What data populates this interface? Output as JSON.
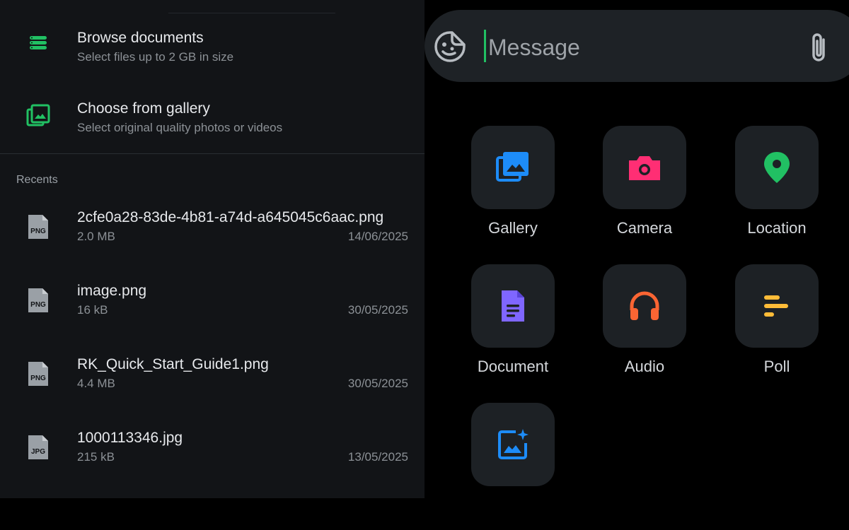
{
  "attach_panel": {
    "options": [
      {
        "title": "Browse documents",
        "subtitle": "Select files up to 2 GB in size",
        "icon": "document-stack-icon"
      },
      {
        "title": "Choose from gallery",
        "subtitle": "Select original quality photos or videos",
        "icon": "gallery-icon"
      }
    ],
    "recents_label": "Recents",
    "files": [
      {
        "name": "2cfe0a28-83de-4b81-a74d-a645045c6aac.png",
        "size": "2.0 MB",
        "date": "14/06/2025",
        "type": "PNG"
      },
      {
        "name": "image.png",
        "size": "16 kB",
        "date": "30/05/2025",
        "type": "PNG"
      },
      {
        "name": "RK_Quick_Start_Guide1.png",
        "size": "4.4 MB",
        "date": "30/05/2025",
        "type": "PNG"
      },
      {
        "name": "1000113346.jpg",
        "size": "215 kB",
        "date": "13/05/2025",
        "type": "JPG"
      }
    ]
  },
  "composer": {
    "placeholder": "Message",
    "left_icon": "sticker-icon",
    "right_icon": "paperclip-icon"
  },
  "attach_menu": {
    "items": [
      {
        "label": "Gallery",
        "icon": "gallery-icon",
        "color": "#1d8cf8"
      },
      {
        "label": "Camera",
        "icon": "camera-icon",
        "color": "#ff2e74"
      },
      {
        "label": "Location",
        "icon": "location-pin-icon",
        "color": "#21c063"
      },
      {
        "label": "Document",
        "icon": "document-icon",
        "color": "#7f66ff"
      },
      {
        "label": "Audio",
        "icon": "headphones-icon",
        "color": "#fa6533"
      },
      {
        "label": "Poll",
        "icon": "poll-icon",
        "color": "#ffbc38"
      },
      {
        "label": "",
        "icon": "ai-image-icon",
        "color": "#1d8cf8"
      }
    ]
  },
  "colors": {
    "accent": "#21c063",
    "panel_bg": "#121417",
    "tile_bg": "#1d2125"
  }
}
